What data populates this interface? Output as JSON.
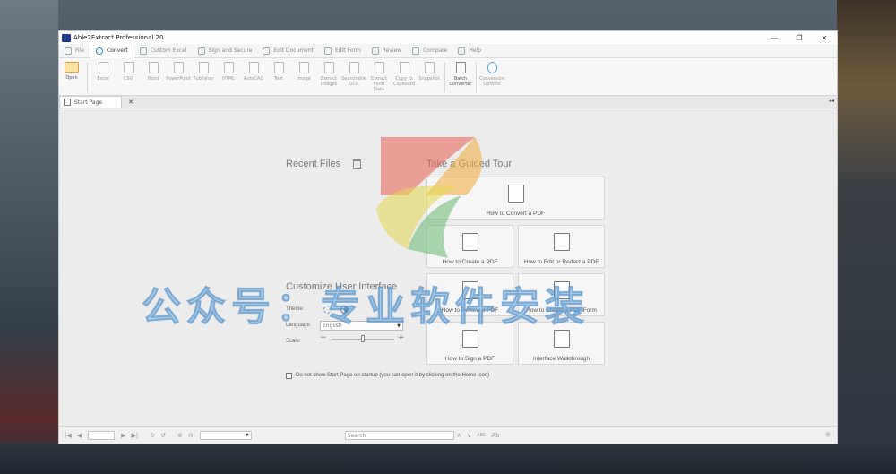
{
  "window": {
    "title": "Able2Extract Professional 20",
    "controls": [
      "—",
      "❐",
      "✕"
    ]
  },
  "menu": {
    "items": [
      {
        "label": "File",
        "active": false
      },
      {
        "label": "Convert",
        "active": true
      },
      {
        "label": "Custom Excel",
        "active": false
      },
      {
        "label": "Sign and Secure",
        "active": false
      },
      {
        "label": "Edit Document",
        "active": false
      },
      {
        "label": "Edit Form",
        "active": false
      },
      {
        "label": "Review",
        "active": false
      },
      {
        "label": "Compare",
        "active": false
      },
      {
        "label": "Help",
        "active": false
      }
    ]
  },
  "ribbon": {
    "buttons": [
      {
        "label": "Open",
        "style": "open"
      },
      {
        "label": "Excel",
        "style": "normal"
      },
      {
        "label": "CSV",
        "style": "normal"
      },
      {
        "label": "Word",
        "style": "normal"
      },
      {
        "label": "PowerPoint",
        "style": "normal"
      },
      {
        "label": "Publisher",
        "style": "normal"
      },
      {
        "label": "HTML",
        "style": "normal"
      },
      {
        "label": "AutoCAD",
        "style": "normal"
      },
      {
        "label": "Text",
        "style": "normal"
      },
      {
        "label": "Image",
        "style": "normal"
      },
      {
        "label": "Extract Images",
        "style": "normal"
      },
      {
        "label": "Searchable OCR",
        "style": "normal"
      },
      {
        "label": "Extract Form Data",
        "style": "normal"
      },
      {
        "label": "Copy to Clipboard",
        "style": "normal"
      },
      {
        "label": "Snapshot",
        "style": "normal"
      },
      {
        "label": "Batch Converter",
        "style": "dark"
      },
      {
        "label": "Conversion Options",
        "style": "conv"
      }
    ]
  },
  "tabs": {
    "start_page": "Start Page",
    "close": "✕",
    "collapse": "◂◂"
  },
  "start": {
    "recent_files": "Recent Files",
    "guided_tour": "Take a Guided Tour",
    "customize": "Customize User Interface",
    "theme_label": "Theme:",
    "language_label": "Language:",
    "language_value": "English",
    "scale_label": "Scale:",
    "scale_minus": "−",
    "scale_plus": "+",
    "scale_level": 0.5,
    "startup_text": "Do not show Start Page on startup (you can open it by clicking on the Home icon)"
  },
  "tour_cards": [
    {
      "label": "How to Convert a PDF"
    },
    {
      "label": "How to Create a PDF"
    },
    {
      "label": "How to Edit or Redact a PDF"
    },
    {
      "label": "How to Review a PDF"
    },
    {
      "label": "How to Create a PDF Form"
    },
    {
      "label": "How to Sign a PDF"
    },
    {
      "label": "Interface Walkthrough"
    }
  ],
  "statusbar": {
    "first": "|◀",
    "prev": "◀",
    "next": "▶",
    "last": "▶|",
    "rotate_cw": "↻",
    "rotate_ccw": "↺",
    "zoom_in": "⊕",
    "zoom_out": "⊖",
    "search_placeholder": "Search",
    "search_prev": "∧",
    "search_next": "∨",
    "match_case": "ABC",
    "font_ab": "Ab",
    "settings": "☼"
  },
  "watermark": "公众号：专业软件安装",
  "colors": {
    "accent": "#2a8fd4",
    "open_folder": "#ffe2a6"
  }
}
